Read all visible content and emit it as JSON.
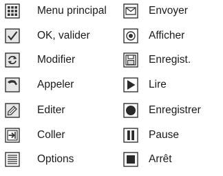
{
  "left_column": [
    {
      "label": "Menu principal",
      "icon": "menu-grid-icon"
    },
    {
      "label": "OK, valider",
      "icon": "checkmark-icon"
    },
    {
      "label": "Modifier",
      "icon": "refresh-arrows-icon"
    },
    {
      "label": "Appeler",
      "icon": "phone-handset-icon"
    },
    {
      "label": "Editer",
      "icon": "pencil-icon"
    },
    {
      "label": "Coller",
      "icon": "paste-arrow-icon"
    },
    {
      "label": "Options",
      "icon": "options-list-icon"
    }
  ],
  "right_column": [
    {
      "label": "Envoyer",
      "icon": "envelope-icon"
    },
    {
      "label": "Afficher",
      "icon": "eye-icon"
    },
    {
      "label": "Enregist.",
      "icon": "save-floppy-icon"
    },
    {
      "label": "Lire",
      "icon": "play-icon"
    },
    {
      "label": "Enregistrer",
      "icon": "record-icon"
    },
    {
      "label": "Pause",
      "icon": "pause-icon"
    },
    {
      "label": "Arrêt",
      "icon": "stop-icon"
    }
  ],
  "colors": {
    "icon_stroke": "#333333",
    "icon_fill_light": "#d9d9d9",
    "icon_fill_dark": "#2a2a2a",
    "text": "#1a1a1a"
  }
}
